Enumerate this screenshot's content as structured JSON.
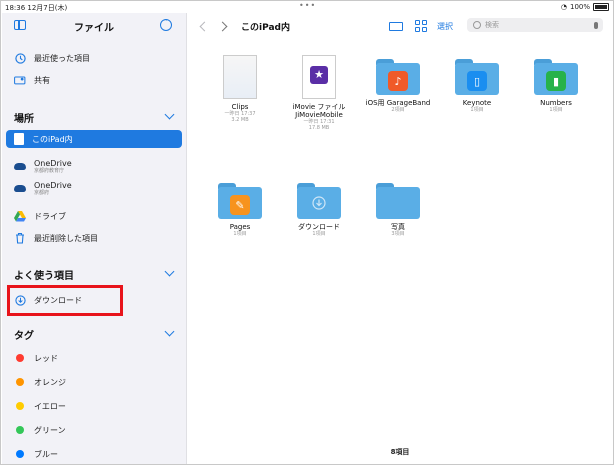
{
  "status": {
    "time": "18:36 12月7日(木)",
    "battery": "100%"
  },
  "sidebar": {
    "title": "ファイル",
    "top_items": [
      {
        "label": "最近使った項目",
        "icon": "clock-icon"
      },
      {
        "label": "共有",
        "icon": "shared-folder-icon"
      }
    ],
    "locations_header": "場所",
    "locations": [
      {
        "label": "このiPad内",
        "icon": "ipad-icon",
        "selected": true
      },
      {
        "label": "OneDrive",
        "sub": "京都府教育庁",
        "icon": "cloud-icon"
      },
      {
        "label": "OneDrive",
        "sub": "京都府",
        "icon": "cloud-icon"
      },
      {
        "label": "ドライブ",
        "icon": "google-drive-icon"
      },
      {
        "label": "最近削除した項目",
        "icon": "trash-icon"
      }
    ],
    "favorites_header": "よく使う項目",
    "favorites": [
      {
        "label": "ダウンロード",
        "icon": "download-icon"
      }
    ],
    "tags_header": "タグ",
    "tags": [
      {
        "label": "レッド",
        "color": "#ff3b30"
      },
      {
        "label": "オレンジ",
        "color": "#ff9500"
      },
      {
        "label": "イエロー",
        "color": "#ffcc00"
      },
      {
        "label": "グリーン",
        "color": "#34c759"
      },
      {
        "label": "ブルー",
        "color": "#007aff"
      }
    ]
  },
  "toolbar": {
    "title": "このiPad内",
    "select_label": "選択",
    "search_placeholder": "検索"
  },
  "items": [
    {
      "name": "Clips",
      "meta1": "一昨日 17:37",
      "meta2": "3.2 MB",
      "kind": "doc"
    },
    {
      "name": "iMovie ファイルJiMovieMobile",
      "meta1": "一昨日 17:31",
      "meta2": "17.8 MB",
      "kind": "imovie"
    },
    {
      "name": "iOS用 GarageBand",
      "meta1": "2項目",
      "meta2": "",
      "kind": "folder",
      "app": "garageband",
      "app_color": "#f05a28"
    },
    {
      "name": "Keynote",
      "meta1": "1項目",
      "meta2": "",
      "kind": "folder",
      "app": "keynote",
      "app_color": "#1a8ef0"
    },
    {
      "name": "Numbers",
      "meta1": "1項目",
      "meta2": "",
      "kind": "folder",
      "app": "numbers",
      "app_color": "#27b24a"
    },
    {
      "name": "Pages",
      "meta1": "1項目",
      "meta2": "",
      "kind": "folder",
      "app": "pages",
      "app_color": "#f7931e"
    },
    {
      "name": "ダウンロード",
      "meta1": "1項目",
      "meta2": "",
      "kind": "folder",
      "app": "download"
    },
    {
      "name": "写真",
      "meta1": "3項目",
      "meta2": "",
      "kind": "folder",
      "app": ""
    }
  ],
  "footer": "8項目",
  "colors": {
    "accent": "#1f7ae0",
    "folder": "#5aaee6",
    "folder_tab": "#4a9ed8",
    "highlight_box": "#e8141b"
  }
}
